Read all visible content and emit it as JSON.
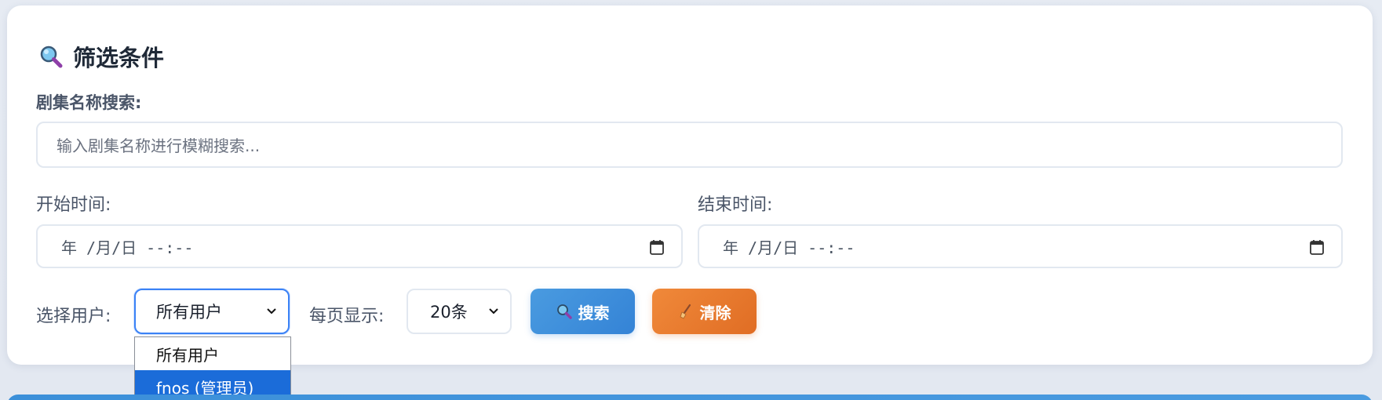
{
  "filter": {
    "title": "筛选条件",
    "title_icon": "magnifier-icon",
    "name_search": {
      "label": "剧集名称搜索:",
      "placeholder": "输入剧集名称进行模糊搜索..."
    },
    "start_time": {
      "label": "开始时间:",
      "value": "年 /月/日 --:--"
    },
    "end_time": {
      "label": "结束时间:",
      "value": "年 /月/日 --:--"
    },
    "user_select": {
      "label": "选择用户:",
      "value": "所有用户",
      "options": [
        "所有用户",
        "fnos (管理员)"
      ],
      "highlighted": "fnos (管理员)"
    },
    "page_size": {
      "label": "每页显示:",
      "value": "20条"
    },
    "buttons": {
      "search": "搜索",
      "clear": "清除"
    }
  },
  "colors": {
    "accent_blue": "#3483d6",
    "accent_orange": "#e06d24",
    "focus_border": "#3b82f6",
    "dropdown_highlight": "#1b6cd9"
  }
}
